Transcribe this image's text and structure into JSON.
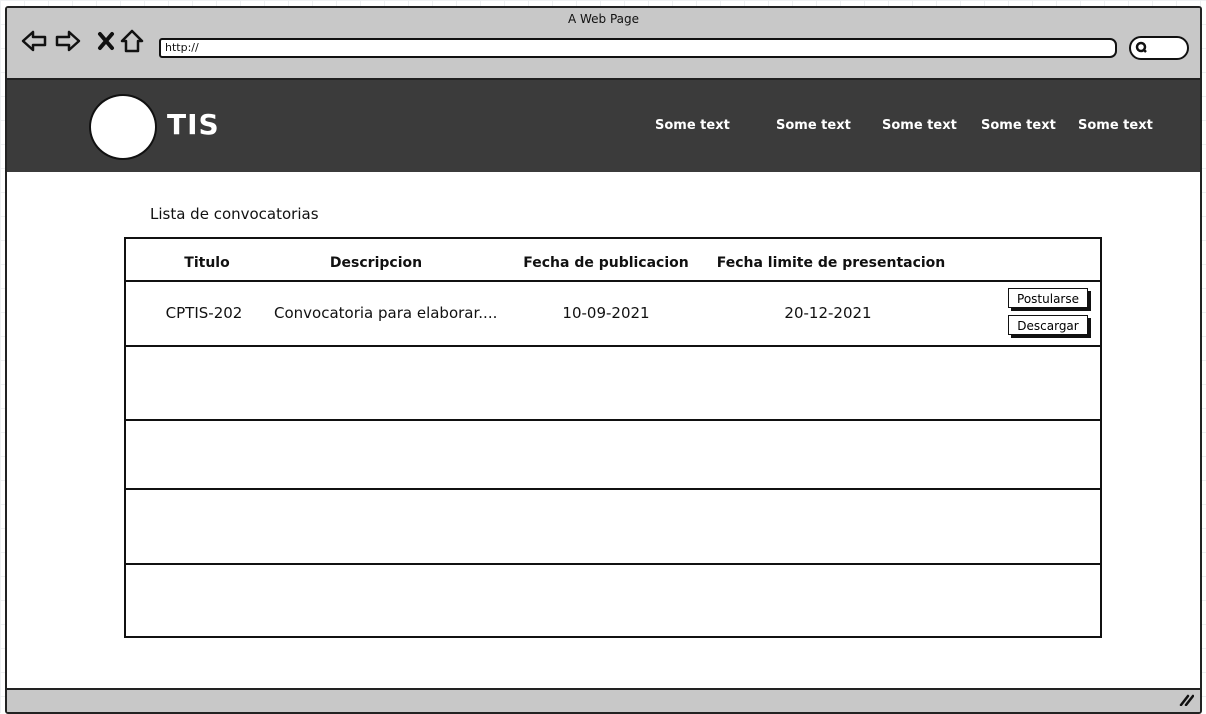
{
  "window": {
    "title": "A Web Page"
  },
  "browser": {
    "url": "http://",
    "icons": [
      "back-arrow-icon",
      "forward-arrow-icon",
      "close-x-icon",
      "home-icon",
      "search-icon",
      "resize-grip-icon"
    ]
  },
  "header": {
    "brand": "TIS",
    "nav": [
      "Some text",
      "Some text",
      "Some text",
      "Some text",
      "Some text"
    ]
  },
  "main": {
    "subtitle": "Lista de convocatorias",
    "table": {
      "columns": [
        "Titulo",
        "Descripcion",
        "Fecha de publicacion",
        "Fecha limite de presentacion",
        ""
      ],
      "rows": [
        {
          "titulo": "CPTIS-202",
          "descripcion": "Convocatoria para elaborar....",
          "fecha_publicacion": "10-09-2021",
          "fecha_limite": "20-12-2021",
          "actions": [
            "Postularse",
            "Descargar"
          ]
        }
      ],
      "empty_rows": 4
    }
  },
  "colors": {
    "chrome": "#c8c8c8",
    "header": "#3b3b3b",
    "ink": "#111111"
  }
}
